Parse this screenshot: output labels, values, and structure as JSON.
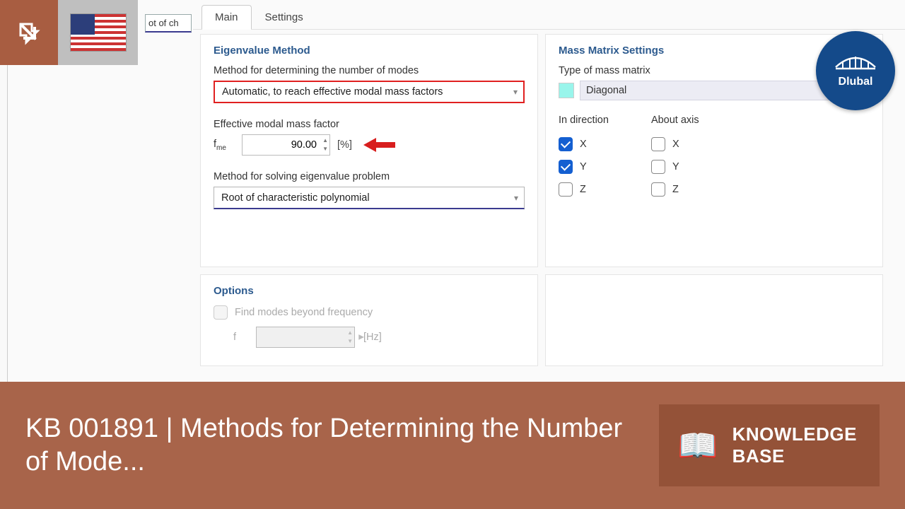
{
  "tabs": {
    "main": "Main",
    "settings": "Settings"
  },
  "eigenvalue": {
    "section": "Eigenvalue Method",
    "method_label": "Method for determining the number of modes",
    "method_value": "Automatic, to reach effective modal mass factors",
    "factor_label": "Effective modal mass factor",
    "fme_symbol": "me",
    "fme_value": "90.00",
    "fme_unit": "[%]",
    "solve_label": "Method for solving eigenvalue problem",
    "solve_value": "Root of characteristic polynomial"
  },
  "mass": {
    "section": "Mass Matrix Settings",
    "type_label": "Type of mass matrix",
    "type_value": "Diagonal",
    "in_direction": "In direction",
    "about_axis": "About axis",
    "dir": {
      "x": "X",
      "y": "Y",
      "z": "Z"
    },
    "axis": {
      "x": "X",
      "y": "Y",
      "z": "Z"
    }
  },
  "options": {
    "section": "Options",
    "find_beyond": "Find modes beyond frequency",
    "f": "f",
    "f_unit": "[Hz]"
  },
  "left_trace": "ot of ch",
  "badge": {
    "brand": "Dlubal"
  },
  "footer": {
    "title": "KB 001891 | Methods for Determining the Number of Mode...",
    "kb_line1": "KNOWLEDGE",
    "kb_line2": "BASE"
  }
}
